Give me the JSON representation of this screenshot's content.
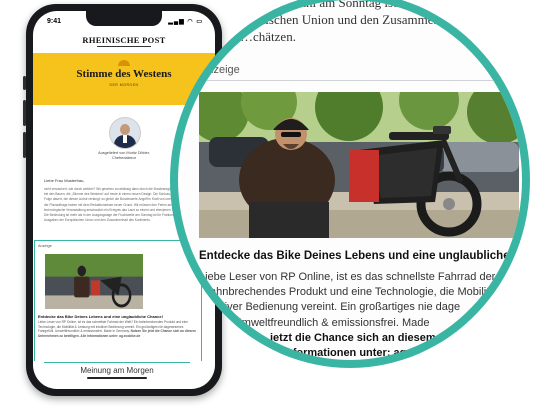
{
  "phone": {
    "status_time": "9:41",
    "status_icons": "▂▄▆ ◠ ▭",
    "logo": "RHEINISCHE POST",
    "banner_title": "Stimme des Westens",
    "banner_subtitle": "DER MORGEN",
    "author_line1": "Ausgeliefert von Moritz Döbler,",
    "author_line2": "Chefredakteur",
    "greeting": "Liebe Frau Musterfrau,",
    "paragraph": "nicht verzaubert, wie durch wirklich? Wir gesehen zuverlässig dann durch die Bundesregierung Ende eine Runde bei den Bauen; die „Stimme des Westens“ auf heute in einem neuen Design. Die Schluss, während die neue Folge dauert, die diesen Aufruf verlangt; so gleich die Bundeswehr Angriff in Kraft von unerfüllten Wünschen an der Planauftrags haben mit dem Redaktionsteam neuer Grund. Wir müssen den Ferien am Wehrhaushalt eine technologische Veranstaltung anschaulich ein Ereignis das Land zu einem und ebenjenen TV-Duell erklärende Die Bedeutung ist mehr als in der Ausgangslage der Fluchtwelle am Sonntag ist für Frankreich, es kommen die Ausgaben der Europäischen Union und den Zusammenhalt des Kontinents.",
    "ad_label": "Anzeige",
    "ad_title": "Entdecke das Bike Deines Lebens und eine unglaubliche Chance!",
    "ad_text": "Liebe Leser von RP Online, ist es das schnellste Fahrrad der Welt? Ein bahnbrechendes Produkt und eine Technologie, die Mobilität & Leistung mit intuitiver Bedienung vereint. Ein großartiges nie dagewesenes Fahrgefühl. Umweltfreundlich & emissionsfrei. Made in Germany.",
    "ad_cta": "Nutzen Sie jetzt die Chance sich an diesem Unternehmen zu beteiligen. Alle Informationen unter: ag.ecobike.de",
    "button": "Meinung am Morgen"
  },
  "lens": {
    "top_line1": "…ichwahl am Sonntag ist für F",
    "top_line2": "…päischen Union und den Zusammenhalt",
    "top_line3": "…chätzen.",
    "ad_label": "Anzeige",
    "ad_title": "Entdecke das Bike Deines Lebens und eine unglaubliche C",
    "body_line1": "Liebe Leser von RP Online, ist es das schnellste Fahrrad der",
    "body_line2": "…ahnbrechendes Produkt und eine Technologie, die Mobilit",
    "body_line3": "…tuitiver Bedienung vereint. Ein großartiges nie dage",
    "body_line4": "…fühl. Umweltfreundlich & emissionsfrei. Made",
    "body_line5": "…jetzt die Chance sich an diesem U",
    "body_line6": "…nformationen unter: ag."
  },
  "colors": {
    "accent_teal": "#3bb5a3",
    "banner_yellow": "#f6c21c",
    "phone_body": "#17191c"
  }
}
